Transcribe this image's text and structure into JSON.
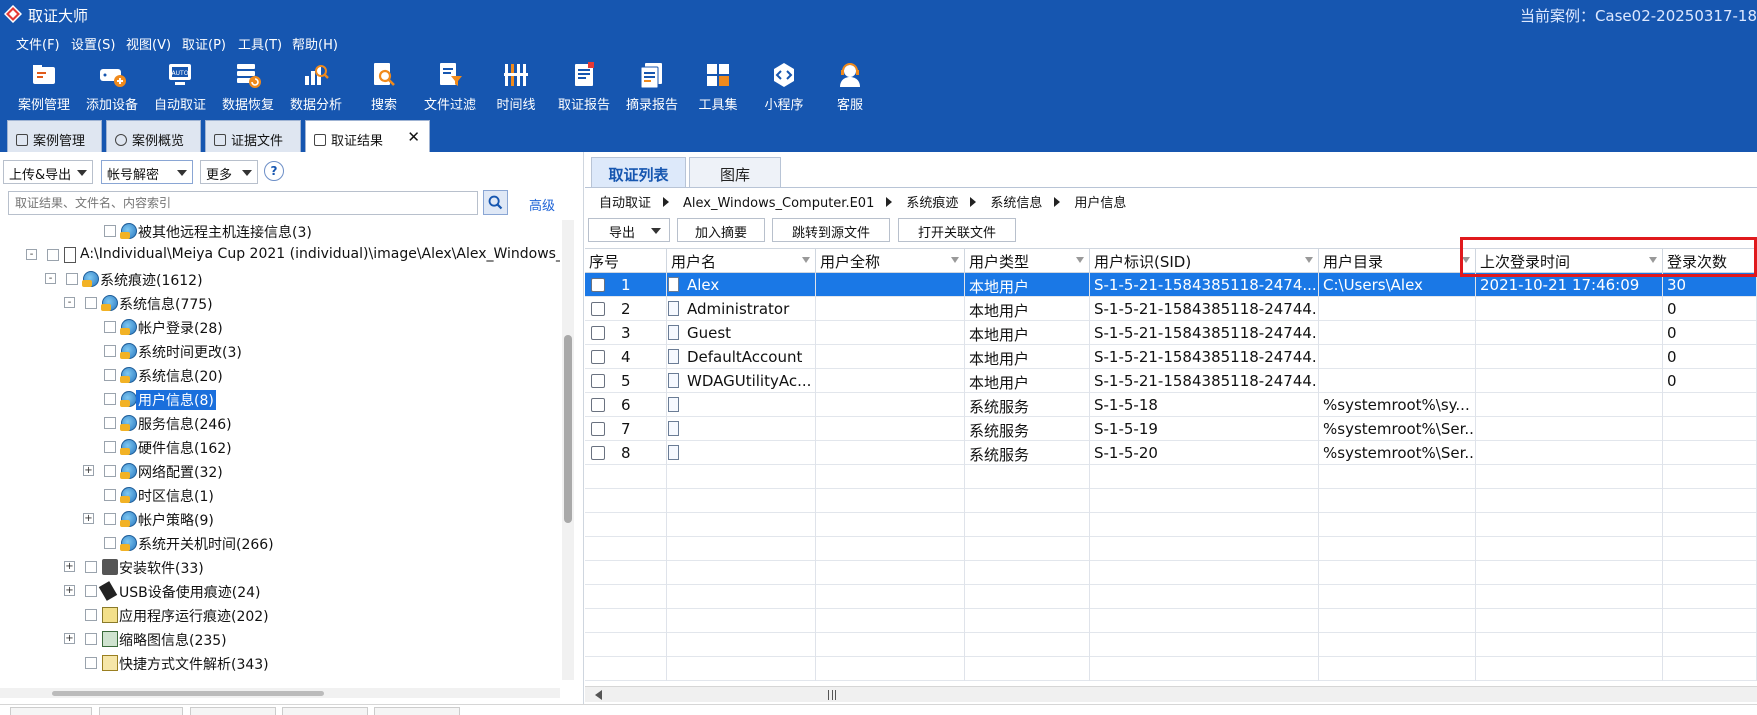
{
  "window": {
    "title": "取证大师",
    "case_label": "当前案例：Case02-20250317-18"
  },
  "menu": [
    "文件(F)",
    "设置(S)",
    "视图(V)",
    "取证(P)",
    "工具(T)",
    "帮助(H)"
  ],
  "toolbar": [
    {
      "label": "案例管理",
      "icon": "case-management-icon"
    },
    {
      "label": "添加设备",
      "icon": "add-device-icon"
    },
    {
      "label": "自动取证",
      "icon": "auto-forensics-icon"
    },
    {
      "label": "数据恢复",
      "icon": "data-recovery-icon"
    },
    {
      "label": "数据分析",
      "icon": "data-analysis-icon"
    },
    {
      "label": "搜索",
      "icon": "search-icon"
    },
    {
      "label": "文件过滤",
      "icon": "file-filter-icon"
    },
    {
      "label": "时间线",
      "icon": "timeline-icon"
    },
    {
      "label": "取证报告",
      "icon": "report-icon"
    },
    {
      "label": "摘录报告",
      "icon": "excerpt-report-icon"
    },
    {
      "label": "工具集",
      "icon": "toolset-icon"
    },
    {
      "label": "小程序",
      "icon": "mini-program-icon"
    },
    {
      "label": "客服",
      "icon": "customer-service-icon"
    }
  ],
  "doc_tabs": [
    "案例管理",
    "案例概览",
    "证据文件",
    "取证结果"
  ],
  "doc_tab_close": "✕",
  "left": {
    "upload_export": "上传&导出",
    "account_decrypt": "帐号解密",
    "more": "更多",
    "help": "?",
    "search_placeholder": "取证结果、文件名、内容索引",
    "advanced": "高级",
    "tree": [
      {
        "label": "被其他远程主机连接信息(3)"
      },
      {
        "label": "A:\\Individual\\Meiya Cup 2021 (individual)\\image\\Alex\\Alex_Windows_Computer.E01",
        "expander": "-"
      },
      {
        "label": "系统痕迹(1612)",
        "expander": "-"
      },
      {
        "label": "系统信息(775)",
        "expander": "-"
      },
      {
        "label": "帐户登录(28)"
      },
      {
        "label": "系统时间更改(3)"
      },
      {
        "label": "系统信息(20)"
      },
      {
        "label": "用户信息(8)",
        "selected": true
      },
      {
        "label": "服务信息(246)"
      },
      {
        "label": "硬件信息(162)"
      },
      {
        "label": "网络配置(32)",
        "expander": "+"
      },
      {
        "label": "时区信息(1)"
      },
      {
        "label": "帐户策略(9)",
        "expander": "+"
      },
      {
        "label": "系统开关机时间(266)"
      },
      {
        "label": "安装软件(33)",
        "expander": "+"
      },
      {
        "label": "USB设备使用痕迹(24)",
        "expander": "+"
      },
      {
        "label": "应用程序运行痕迹(202)"
      },
      {
        "label": "缩略图信息(235)",
        "expander": "+"
      },
      {
        "label": "快捷方式文件解析(343)"
      }
    ]
  },
  "right": {
    "tabs": [
      "取证列表",
      "图库"
    ],
    "breadcrumb": [
      "自动取证",
      "Alex_Windows_Computer.E01",
      "系统痕迹",
      "系统信息",
      "用户信息"
    ],
    "actions": {
      "export": "导出",
      "add_summary": "加入摘要",
      "jump_source": "跳转到源文件",
      "open_related": "打开关联文件"
    },
    "columns": [
      "序号",
      "用户名",
      "用户全称",
      "用户类型",
      "用户标识(SID)",
      "用户目录",
      "上次登录时间",
      "登录次数"
    ],
    "rows": [
      {
        "seq": "1",
        "name": "Alex",
        "fullname": "",
        "type": "本地用户",
        "sid": "S-1-5-21-1584385118-2474...",
        "dir": "C:\\Users\\Alex",
        "last_login": "2021-10-21 17:46:09",
        "count": "30",
        "selected": true
      },
      {
        "seq": "2",
        "name": "Administrator",
        "fullname": "",
        "type": "本地用户",
        "sid": "S-1-5-21-1584385118-24744...",
        "dir": "",
        "last_login": "",
        "count": "0"
      },
      {
        "seq": "3",
        "name": "Guest",
        "fullname": "",
        "type": "本地用户",
        "sid": "S-1-5-21-1584385118-24744...",
        "dir": "",
        "last_login": "",
        "count": "0"
      },
      {
        "seq": "4",
        "name": "DefaultAccount",
        "fullname": "",
        "type": "本地用户",
        "sid": "S-1-5-21-1584385118-24744...",
        "dir": "",
        "last_login": "",
        "count": "0"
      },
      {
        "seq": "5",
        "name": "WDAGUtilityAc...",
        "fullname": "",
        "type": "本地用户",
        "sid": "S-1-5-21-1584385118-24744...",
        "dir": "",
        "last_login": "",
        "count": "0"
      },
      {
        "seq": "6",
        "name": "",
        "fullname": "",
        "type": "系统服务",
        "sid": "S-1-5-18",
        "dir": "%systemroot%\\sy...",
        "last_login": "",
        "count": ""
      },
      {
        "seq": "7",
        "name": "",
        "fullname": "",
        "type": "系统服务",
        "sid": "S-1-5-19",
        "dir": "%systemroot%\\Ser...",
        "last_login": "",
        "count": ""
      },
      {
        "seq": "8",
        "name": "",
        "fullname": "",
        "type": "系统服务",
        "sid": "S-1-5-20",
        "dir": "%systemroot%\\Ser...",
        "last_login": "",
        "count": ""
      }
    ]
  },
  "colors": {
    "brand_blue": "#1656b0",
    "selection": "#1a78e6",
    "highlight_box": "#e0191d"
  }
}
